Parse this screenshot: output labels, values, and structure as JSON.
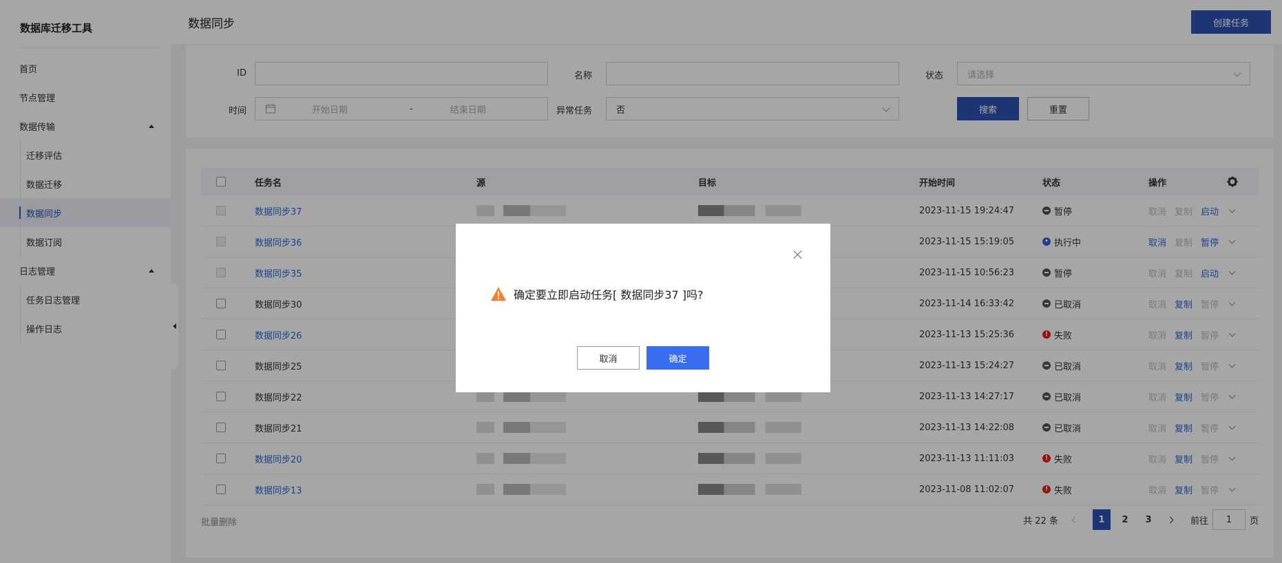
{
  "app": {
    "title": "数据库迁移工具"
  },
  "sidebar": {
    "items": [
      {
        "label": "首页"
      },
      {
        "label": "节点管理"
      },
      {
        "label": "数据传输",
        "children": [
          {
            "label": "迁移评估"
          },
          {
            "label": "数据迁移"
          },
          {
            "label": "数据同步",
            "active": true
          },
          {
            "label": "数据订阅"
          }
        ]
      },
      {
        "label": "日志管理",
        "children": [
          {
            "label": "任务日志管理"
          },
          {
            "label": "操作日志"
          }
        ]
      }
    ]
  },
  "header": {
    "title": "数据同步",
    "create_label": "创建任务"
  },
  "filters": {
    "id_label": "ID",
    "name_label": "名称",
    "status_label": "状态",
    "status_placeholder": "请选择",
    "time_label": "时间",
    "start_placeholder": "开始日期",
    "date_sep": "-",
    "end_placeholder": "结束日期",
    "abnormal_label": "异常任务",
    "abnormal_value": "否",
    "search_label": "搜索",
    "reset_label": "重置"
  },
  "table": {
    "columns": [
      "任务名",
      "源",
      "目标",
      "开始时间",
      "状态",
      "操作"
    ],
    "rows": [
      {
        "name": "数据同步37",
        "time": "2023-11-15 19:24:47",
        "status": "暂停",
        "ops": [
          "取消",
          "复制",
          "启动"
        ]
      },
      {
        "name": "数据同步36",
        "time": "2023-11-15 15:19:05",
        "status": "执行中",
        "ops": [
          "取消",
          "复制",
          "暂停"
        ]
      },
      {
        "name": "数据同步35",
        "time": "2023-11-15 10:56:23",
        "status": "暂停",
        "ops": [
          "取消",
          "复制",
          "启动"
        ]
      },
      {
        "name": "数据同步30",
        "time": "2023-11-14 16:33:42",
        "status": "已取消",
        "ops": [
          "取消",
          "复制",
          "暂停"
        ]
      },
      {
        "name": "数据同步26",
        "time": "2023-11-13 15:25:36",
        "status": "失败",
        "ops": [
          "取消",
          "复制",
          "暂停"
        ]
      },
      {
        "name": "数据同步25",
        "time": "2023-11-13 15:24:27",
        "status": "已取消",
        "ops": [
          "取消",
          "复制",
          "暂停"
        ]
      },
      {
        "name": "数据同步22",
        "time": "2023-11-13 14:27:17",
        "status": "已取消",
        "ops": [
          "取消",
          "复制",
          "暂停"
        ]
      },
      {
        "name": "数据同步21",
        "time": "2023-11-13 14:22:08",
        "status": "已取消",
        "ops": [
          "取消",
          "复制",
          "暂停"
        ]
      },
      {
        "name": "数据同步20",
        "time": "2023-11-13 11:11:03",
        "status": "失败",
        "ops": [
          "取消",
          "复制",
          "暂停"
        ]
      },
      {
        "name": "数据同步13",
        "time": "2023-11-08 11:02:07",
        "status": "失败",
        "ops": [
          "取消",
          "复制",
          "暂停"
        ]
      }
    ]
  },
  "footer": {
    "batch_delete": "批量删除",
    "total": "共 22 条",
    "pages": [
      "1",
      "2",
      "3"
    ],
    "goto_label": "前往",
    "goto_value": "1",
    "page_suffix": "页"
  },
  "modal": {
    "message": "确定要立即启动任务[ 数据同步37 ]吗?",
    "cancel_label": "取消",
    "ok_label": "确定"
  },
  "colors": {
    "primary": "#2e52b4",
    "link": "#2e66d6",
    "danger": "#e02020",
    "modal_ok": "#3a6cf0"
  }
}
